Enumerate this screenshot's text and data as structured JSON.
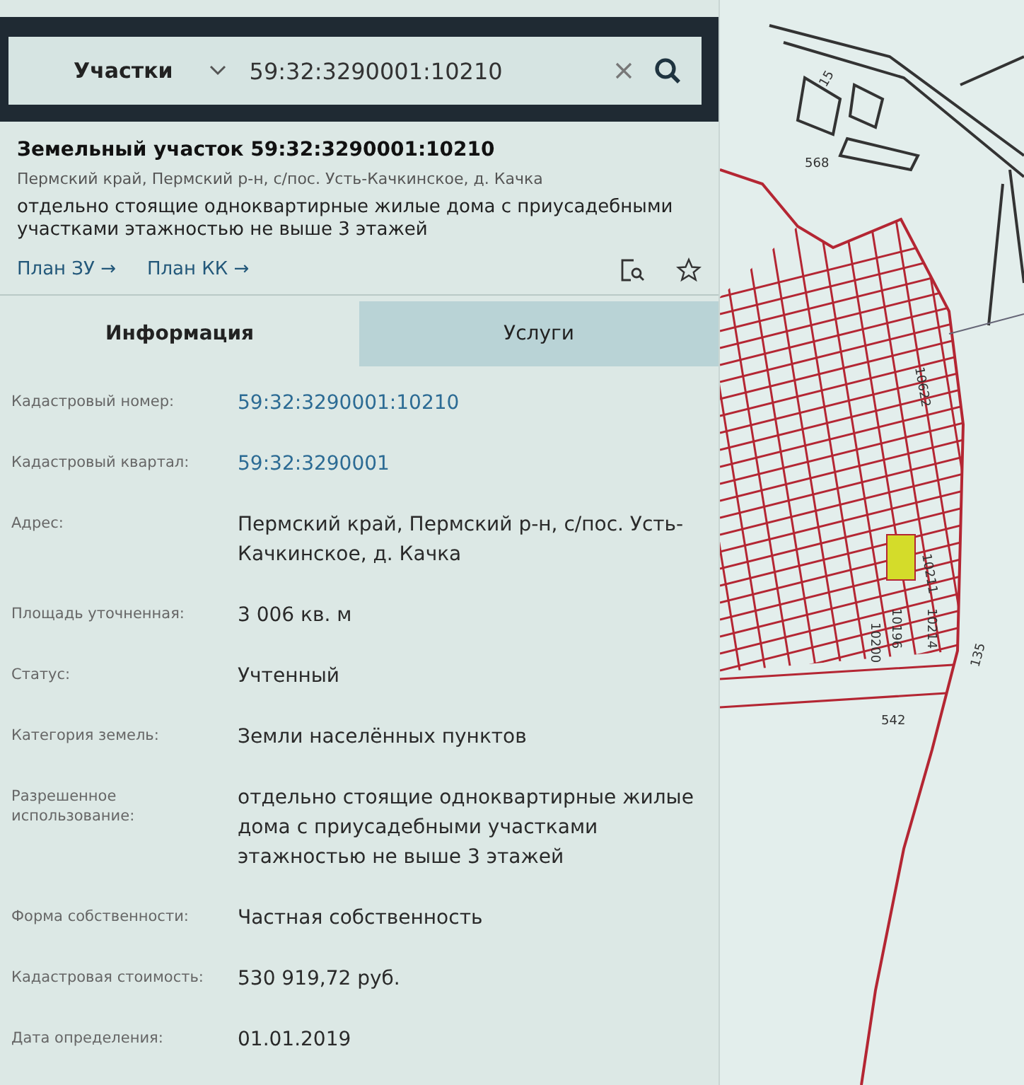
{
  "search": {
    "category": "Участки",
    "value": "59:32:3290001:10210"
  },
  "summary": {
    "title": "Земельный участок 59:32:3290001:10210",
    "address": "Пермский край, Пермский р-н, с/пос. Усть-Качкинское, д. Качка",
    "usage": "отдельно стоящие одноквартирные жилые дома с приусадебными участками этажностью не выше 3 этажей",
    "links": [
      "План ЗУ →",
      "План КК →"
    ]
  },
  "tabs": [
    {
      "label": "Информация",
      "selected": true
    },
    {
      "label": "Услуги",
      "selected": false
    }
  ],
  "fields": [
    {
      "label": "Кадастровый номер:",
      "value": "59:32:3290001:10210",
      "kind": "link"
    },
    {
      "label": "Кадастровый квартал:",
      "value": "59:32:3290001",
      "kind": "link"
    },
    {
      "label": "Адрес:",
      "value": "Пермский край, Пермский р-н, с/пос. Усть-Качкинское, д. Качка",
      "kind": "text"
    },
    {
      "label": "Площадь уточненная:",
      "value": "3 006 кв. м",
      "kind": "text"
    },
    {
      "label": "Статус:",
      "value": "Учтенный",
      "kind": "text"
    },
    {
      "label": "Категория земель:",
      "value": "Земли населённых пунктов",
      "kind": "text"
    },
    {
      "label": "Разрешенное использование:",
      "value": "отдельно стоящие одноквартирные жилые дома с приусадебными участками этажностью не выше 3 этажей",
      "kind": "text"
    },
    {
      "label": "Форма собственности:",
      "value": "Частная собственность",
      "kind": "text"
    },
    {
      "label": "Кадастровая стоимость:",
      "value": "530 919,72 руб.",
      "kind": "text"
    },
    {
      "label": "Дата определения:",
      "value": "01.01.2019",
      "kind": "text"
    }
  ],
  "map": {
    "labels": [
      "15",
      "568",
      "10622",
      "10211",
      "10196",
      "10214",
      "10200",
      "542",
      "135"
    ]
  }
}
